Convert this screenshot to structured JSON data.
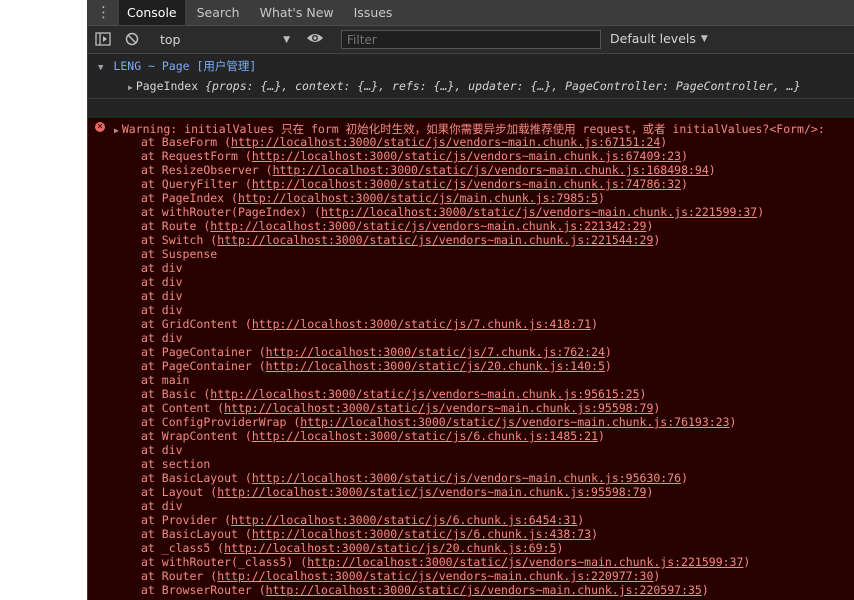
{
  "tabs": [
    "Console",
    "Search",
    "What's New",
    "Issues"
  ],
  "toolbar": {
    "context": "top",
    "filter_placeholder": "Filter",
    "levels": "Default levels"
  },
  "group": {
    "label": "LENG ~ Page [用户管理]",
    "object_name": "PageIndex",
    "object_summary": "{props: {…}, context: {…}, refs: {…}, updater: {…}, PageController: PageController, …}"
  },
  "error": {
    "message": "Warning: initialValues 只在 form 初始化时生效，如果你需要异步加载推荐使用 request，或者 initialValues?<Form/>:",
    "stack": [
      {
        "name": "BaseForm",
        "url": "http://localhost:3000/static/js/vendors~main.chunk.js:67151:24"
      },
      {
        "name": "RequestForm",
        "url": "http://localhost:3000/static/js/vendors~main.chunk.js:67409:23"
      },
      {
        "name": "ResizeObserver",
        "url": "http://localhost:3000/static/js/vendors~main.chunk.js:168498:94"
      },
      {
        "name": "QueryFilter",
        "url": "http://localhost:3000/static/js/vendors~main.chunk.js:74786:32"
      },
      {
        "name": "PageIndex",
        "url": "http://localhost:3000/static/js/main.chunk.js:7985:5"
      },
      {
        "name": "withRouter(PageIndex)",
        "url": "http://localhost:3000/static/js/vendors~main.chunk.js:221599:37"
      },
      {
        "name": "Route",
        "url": "http://localhost:3000/static/js/vendors~main.chunk.js:221342:29"
      },
      {
        "name": "Switch",
        "url": "http://localhost:3000/static/js/vendors~main.chunk.js:221544:29"
      },
      {
        "name": "Suspense",
        "url": ""
      },
      {
        "name": "div",
        "url": ""
      },
      {
        "name": "div",
        "url": ""
      },
      {
        "name": "div",
        "url": ""
      },
      {
        "name": "div",
        "url": ""
      },
      {
        "name": "GridContent",
        "url": "http://localhost:3000/static/js/7.chunk.js:418:71"
      },
      {
        "name": "div",
        "url": ""
      },
      {
        "name": "PageContainer",
        "url": "http://localhost:3000/static/js/7.chunk.js:762:24"
      },
      {
        "name": "PageContainer",
        "url": "http://localhost:3000/static/js/20.chunk.js:140:5"
      },
      {
        "name": "main",
        "url": ""
      },
      {
        "name": "Basic",
        "url": "http://localhost:3000/static/js/vendors~main.chunk.js:95615:25"
      },
      {
        "name": "Content",
        "url": "http://localhost:3000/static/js/vendors~main.chunk.js:95598:79"
      },
      {
        "name": "ConfigProviderWrap",
        "url": "http://localhost:3000/static/js/vendors~main.chunk.js:76193:23"
      },
      {
        "name": "WrapContent",
        "url": "http://localhost:3000/static/js/6.chunk.js:1485:21"
      },
      {
        "name": "div",
        "url": ""
      },
      {
        "name": "section",
        "url": ""
      },
      {
        "name": "BasicLayout",
        "url": "http://localhost:3000/static/js/vendors~main.chunk.js:95630:76"
      },
      {
        "name": "Layout",
        "url": "http://localhost:3000/static/js/vendors~main.chunk.js:95598:79"
      },
      {
        "name": "div",
        "url": ""
      },
      {
        "name": "Provider",
        "url": "http://localhost:3000/static/js/6.chunk.js:6454:31"
      },
      {
        "name": "BasicLayout",
        "url": "http://localhost:3000/static/js/6.chunk.js:438:73"
      },
      {
        "name": "_class5",
        "url": "http://localhost:3000/static/js/20.chunk.js:69:5"
      },
      {
        "name": "withRouter(_class5)",
        "url": "http://localhost:3000/static/js/vendors~main.chunk.js:221599:37"
      },
      {
        "name": "Router",
        "url": "http://localhost:3000/static/js/vendors~main.chunk.js:220977:30"
      },
      {
        "name": "BrowserRouter",
        "url": "http://localhost:3000/static/js/vendors~main.chunk.js:220597:35"
      }
    ]
  }
}
